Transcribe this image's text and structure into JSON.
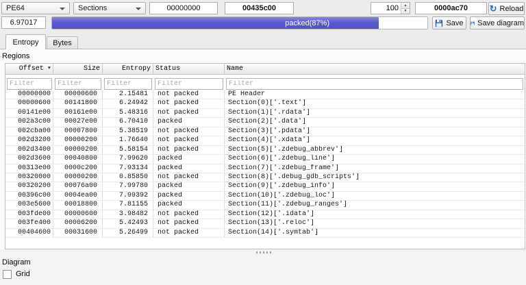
{
  "toolbar": {
    "file_type": "PE64",
    "view_mode": "Sections",
    "offset": "00000000",
    "size": "00435c00",
    "count": "100",
    "address": "0000ac70",
    "reload_label": "Reload",
    "entropy_value": "6.97017",
    "progress": {
      "label": "packed(87%)",
      "percent": 87,
      "fill_color": "#5a5ad2"
    },
    "save_label": "Save",
    "save_diagram_label": "Save diagram"
  },
  "colors": {
    "accent_progress": "#5a5ad2",
    "icon_blue": "#2e6db5"
  },
  "tabs": [
    {
      "label": "Entropy",
      "active": true
    },
    {
      "label": "Bytes",
      "active": false
    }
  ],
  "regions": {
    "section_label": "Regions",
    "table": {
      "columns": [
        "Offset",
        "Size",
        "Entropy",
        "Status",
        "Name"
      ],
      "sort_column": "Offset",
      "sort_indicator": "▼",
      "filter_placeholder": "Filter",
      "rows": [
        {
          "offset": "00000000",
          "size": "00000600",
          "entropy": "2.15481",
          "status": "not packed",
          "name": "PE Header"
        },
        {
          "offset": "00000600",
          "size": "00141800",
          "entropy": "6.24942",
          "status": "not packed",
          "name": "Section(0)['.text']"
        },
        {
          "offset": "00141e00",
          "size": "00161e00",
          "entropy": "5.48316",
          "status": "not packed",
          "name": "Section(1)['.rdata']"
        },
        {
          "offset": "002a3c00",
          "size": "00027e00",
          "entropy": "6.70410",
          "status": "packed",
          "name": "Section(2)['.data']"
        },
        {
          "offset": "002cba00",
          "size": "00007800",
          "entropy": "5.38519",
          "status": "not packed",
          "name": "Section(3)['.pdata']"
        },
        {
          "offset": "002d3200",
          "size": "00000200",
          "entropy": "1.76640",
          "status": "not packed",
          "name": "Section(4)['.xdata']"
        },
        {
          "offset": "002d3400",
          "size": "00000200",
          "entropy": "5.58154",
          "status": "not packed",
          "name": "Section(5)['.zdebug_abbrev']"
        },
        {
          "offset": "002d3600",
          "size": "00040800",
          "entropy": "7.99620",
          "status": "packed",
          "name": "Section(6)['.zdebug_line']"
        },
        {
          "offset": "00313e00",
          "size": "0000c200",
          "entropy": "7.93134",
          "status": "packed",
          "name": "Section(7)['.zdebug_frame']"
        },
        {
          "offset": "00320000",
          "size": "00000200",
          "entropy": "0.85850",
          "status": "not packed",
          "name": "Section(8)['.debug_gdb_scripts']"
        },
        {
          "offset": "00320200",
          "size": "00076a00",
          "entropy": "7.99780",
          "status": "packed",
          "name": "Section(9)['.zdebug_info']"
        },
        {
          "offset": "00396c00",
          "size": "0004ea00",
          "entropy": "7.99392",
          "status": "packed",
          "name": "Section(10)['.zdebug_loc']"
        },
        {
          "offset": "003e5600",
          "size": "00018800",
          "entropy": "7.81155",
          "status": "packed",
          "name": "Section(11)['.zdebug_ranges']"
        },
        {
          "offset": "003fde00",
          "size": "00000600",
          "entropy": "3.98482",
          "status": "not packed",
          "name": "Section(12)['.idata']"
        },
        {
          "offset": "003fe400",
          "size": "00006200",
          "entropy": "5.42493",
          "status": "not packed",
          "name": "Section(13)['.reloc']"
        },
        {
          "offset": "00404600",
          "size": "00031600",
          "entropy": "5.26499",
          "status": "not packed",
          "name": "Section(14)['.symtab']"
        }
      ]
    }
  },
  "diagram": {
    "section_label": "Diagram",
    "grid_checkbox_label": "Grid",
    "grid_checked": false
  }
}
